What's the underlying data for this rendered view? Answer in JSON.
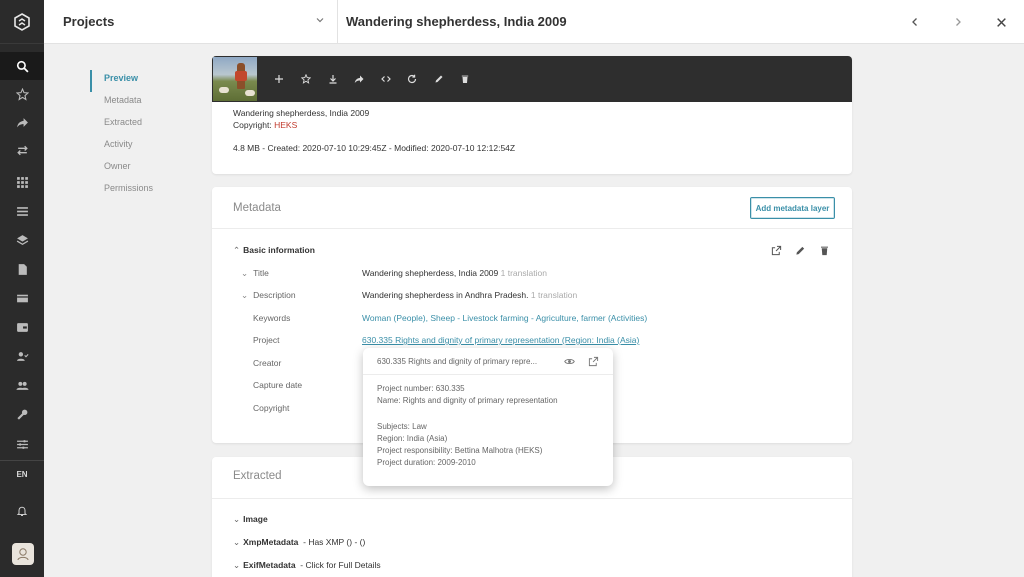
{
  "top_bar": {
    "project_selector": "Projects",
    "record_title": "Wandering shepherdess, India 2009"
  },
  "section_nav": {
    "items": [
      "Preview",
      "Metadata",
      "Extracted",
      "Activity",
      "Owner",
      "Permissions"
    ],
    "active": "Preview"
  },
  "rail": {
    "language": "EN"
  },
  "preview": {
    "caption": "Wandering shepherdess, India 2009",
    "copyright_label": "Copyright:",
    "copyright_value": "HEKS",
    "file_info": "4.8 MB - Created: 2020-07-10 10:29:45Z - Modified: 2020-07-10 12:12:54Z"
  },
  "metadata": {
    "heading": "Metadata",
    "add_button": "Add metadata layer",
    "group_title": "Basic information",
    "rows": {
      "title": {
        "label": "Title",
        "value": "Wandering shepherdess, India 2009",
        "note": "1 translation"
      },
      "description": {
        "label": "Description",
        "value": "Wandering shepherdess in Andhra Pradesh.",
        "note": "1 translation"
      },
      "keywords": {
        "label": "Keywords",
        "value": "Woman (People),  Sheep - Livestock farming - Agriculture, farmer (Activities)"
      },
      "project": {
        "label": "Project",
        "value": "630.335 Rights and dignity of primary representation (Region: India (Asia)"
      },
      "creator": {
        "label": "Creator"
      },
      "capture_date": {
        "label": "Capture date"
      },
      "copyright": {
        "label": "Copyright"
      }
    }
  },
  "popover": {
    "title": "630.335 Rights and dignity of primary repre...",
    "project_number": "Project number: 630.335",
    "name": "Name: Rights and dignity of primary representation",
    "subjects": "Subjects: Law",
    "region": "Region: India (Asia)",
    "responsibility": "Project responsibility: Bettina Malhotra (HEKS)",
    "duration": "Project duration: 2009-2010"
  },
  "extracted": {
    "heading": "Extracted",
    "image_label": "Image",
    "xmp_label": "XmpMetadata",
    "xmp_value": "- Has XMP () - ()",
    "exif_label": "ExifMetadata",
    "exif_value": "- Click for Full Details"
  },
  "colors": {
    "accent": "#3a8fa8",
    "rail_bg": "#2b2b2b",
    "copyright_red": "#c0392b"
  }
}
